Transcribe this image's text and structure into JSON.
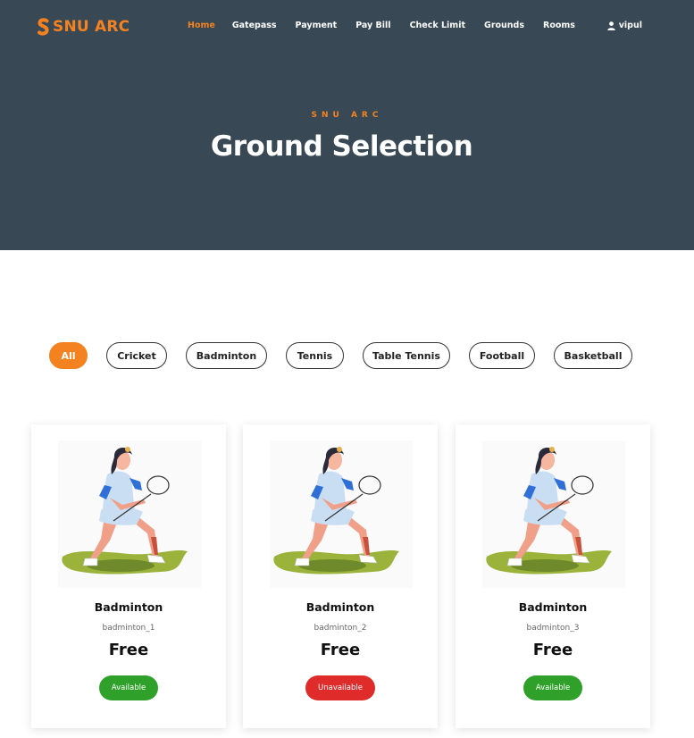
{
  "header": {
    "brand": "SNU ARC",
    "nav": [
      "Home",
      "Gatepass",
      "Payment",
      "Pay Bill",
      "Check Limit",
      "Grounds",
      "Rooms"
    ],
    "active_nav": "Home",
    "user": "vipul"
  },
  "hero": {
    "kicker": "SNU ARC",
    "title": "Ground Selection"
  },
  "filters": [
    "All",
    "Cricket",
    "Badminton",
    "Tennis",
    "Table Tennis",
    "Football",
    "Basketball"
  ],
  "active_filter": "All",
  "cards": [
    {
      "name": "Badminton",
      "code": "badminton_1",
      "price": "Free",
      "status": "Available",
      "image_icon": "badminton-player-illustration"
    },
    {
      "name": "Badminton",
      "code": "badminton_2",
      "price": "Free",
      "status": "Unavailable",
      "image_icon": "badminton-player-illustration"
    },
    {
      "name": "Badminton",
      "code": "badminton_3",
      "price": "Free",
      "status": "Available",
      "image_icon": "badminton-player-illustration"
    }
  ],
  "colors": {
    "accent": "#f58220",
    "hero_bg": "#384955",
    "available": "#2fa12a",
    "unavailable": "#e02b2b"
  }
}
